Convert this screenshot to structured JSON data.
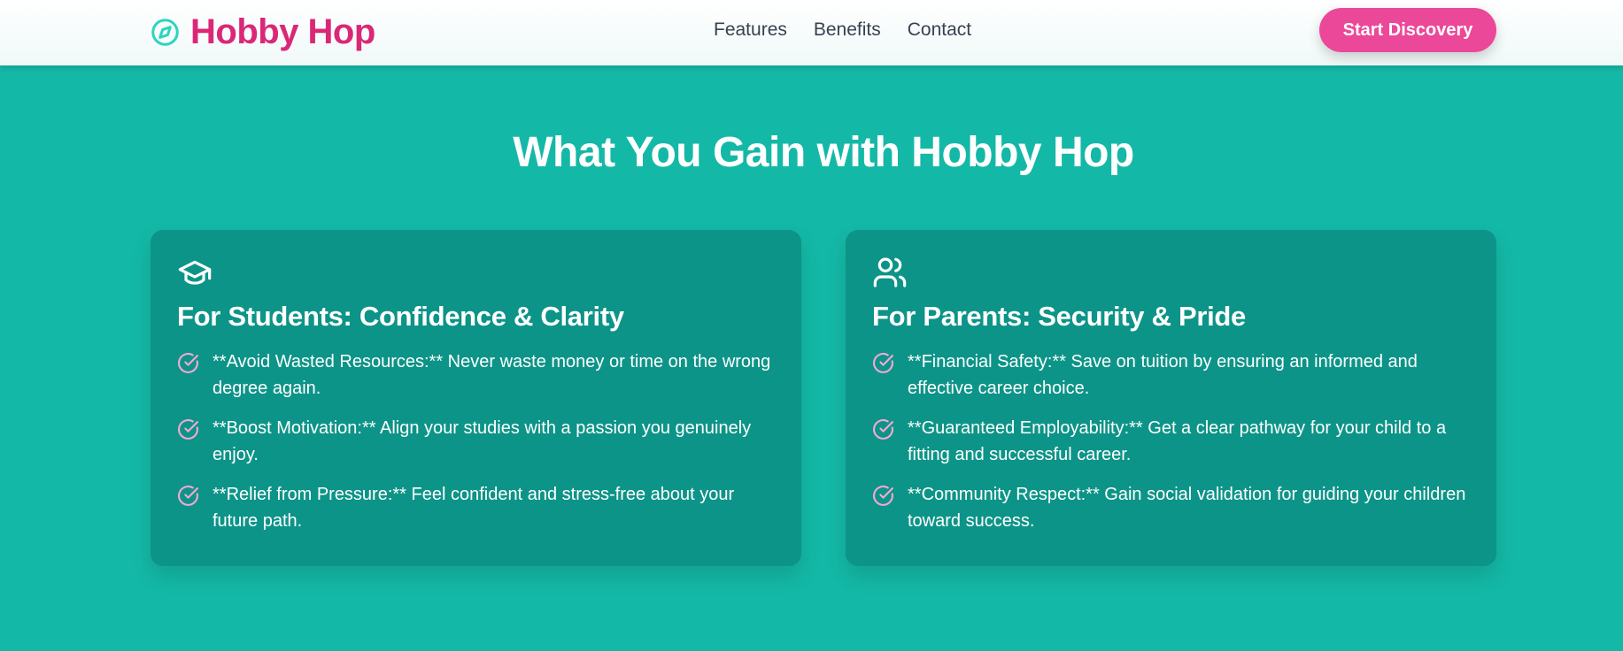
{
  "header": {
    "brand": "Hobby Hop",
    "brand_color": "#db2777",
    "logo_icon": "compass-icon",
    "nav": [
      {
        "label": "Features"
      },
      {
        "label": "Benefits"
      },
      {
        "label": "Contact"
      }
    ],
    "cta_label": "Start Discovery",
    "cta_color": "#ec4899"
  },
  "main": {
    "section_title": "What You Gain with Hobby Hop",
    "background_color": "#14b8a6",
    "card_color": "#0d9488",
    "check_icon_color": "#f9a8d4",
    "cards": [
      {
        "icon": "graduation-cap-icon",
        "title": "For Students: Confidence & Clarity",
        "items": [
          "**Avoid Wasted Resources:** Never waste money or time on the wrong degree again.",
          "**Boost Motivation:** Align your studies with a passion you genuinely enjoy.",
          "**Relief from Pressure:** Feel confident and stress-free about your future path."
        ]
      },
      {
        "icon": "users-icon",
        "title": "For Parents: Security & Pride",
        "items": [
          "**Financial Safety:** Save on tuition by ensuring an informed and effective career choice.",
          "**Guaranteed Employability:** Get a clear pathway for your child to a fitting and successful career.",
          "**Community Respect:** Gain social validation for guiding your children toward success."
        ]
      }
    ]
  }
}
